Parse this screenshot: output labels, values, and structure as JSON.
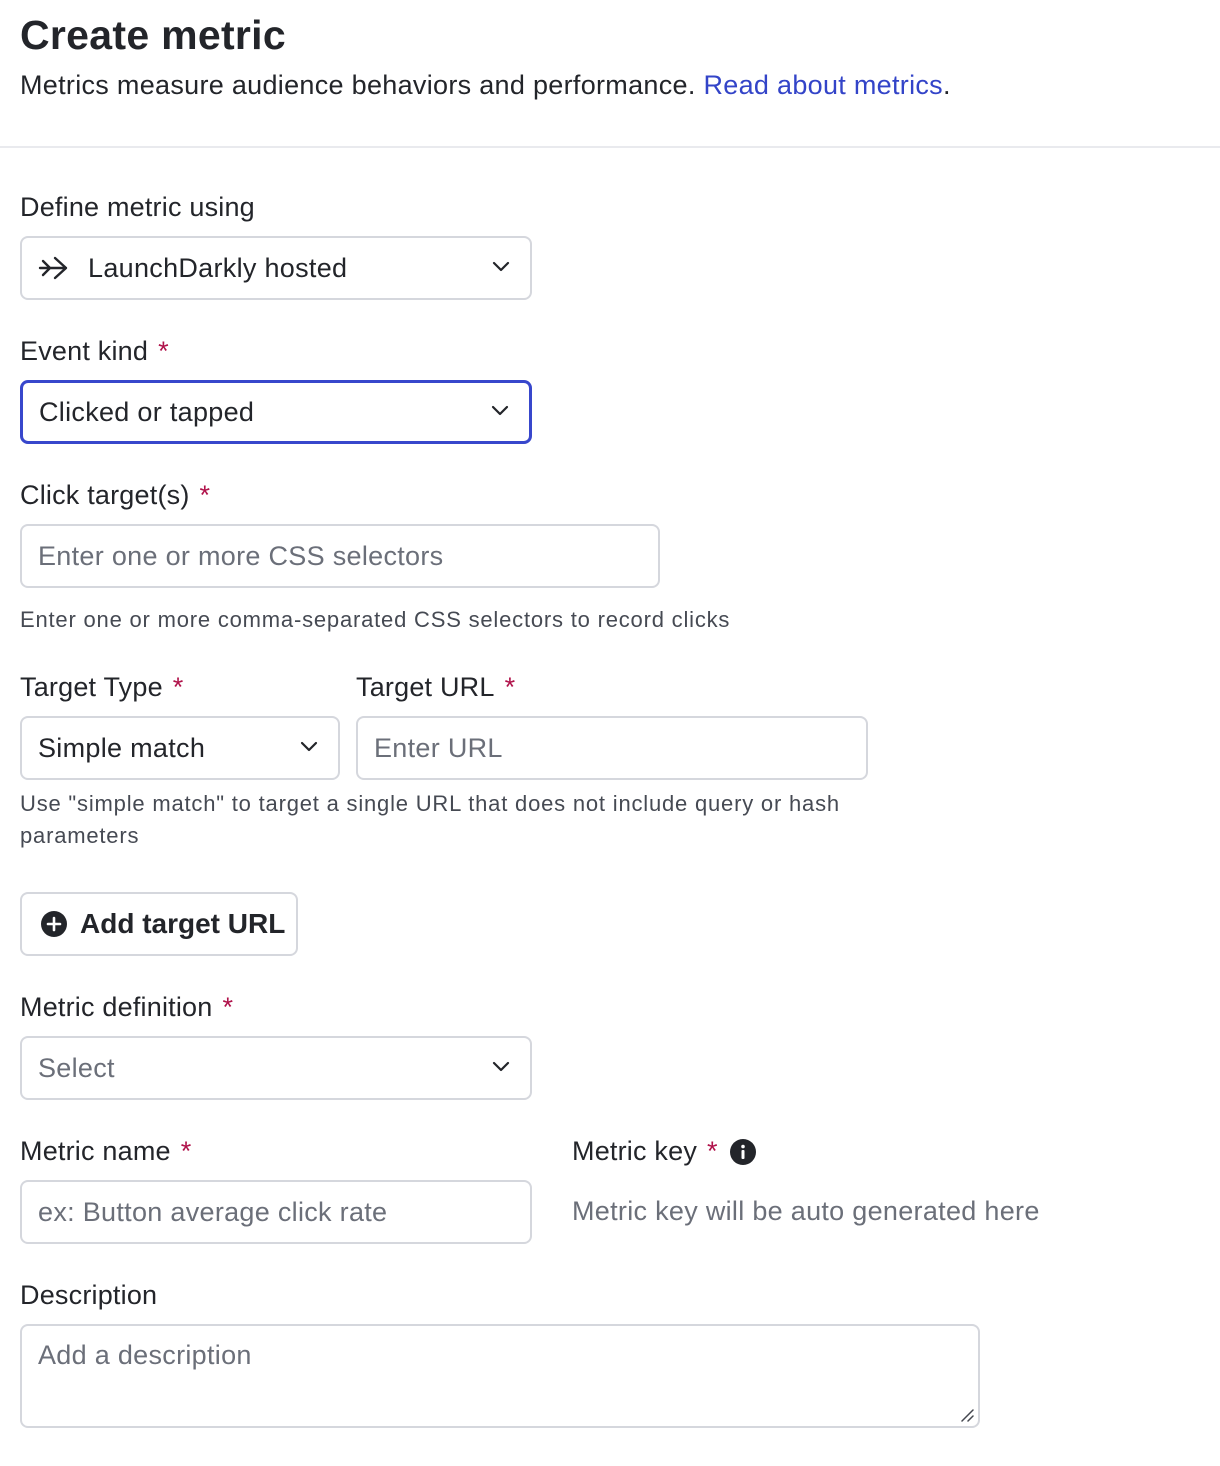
{
  "header": {
    "title": "Create metric",
    "subtitle": "Metrics measure audience behaviors and performance.",
    "link": "Read about metrics",
    "link_suffix": "."
  },
  "define_metric": {
    "label": "Define metric using",
    "value": "LaunchDarkly hosted",
    "icon": "arrow-right-icon"
  },
  "event_kind": {
    "label": "Event kind",
    "required": "*",
    "value": "Clicked or tapped"
  },
  "click_targets": {
    "label": "Click target(s)",
    "required": "*",
    "placeholder": "Enter one or more CSS selectors",
    "help": "Enter one or more comma-separated CSS selectors to record clicks"
  },
  "target_type": {
    "label": "Target Type",
    "required": "*",
    "value": "Simple match"
  },
  "target_url": {
    "label": "Target URL",
    "required": "*",
    "placeholder": "Enter URL",
    "help": "Use \"simple match\" to target a single URL that does not include query or hash parameters"
  },
  "add_target": {
    "label": "Add target URL",
    "icon": "plus-circle-icon"
  },
  "metric_definition": {
    "label": "Metric definition",
    "required": "*",
    "placeholder": "Select"
  },
  "metric_name": {
    "label": "Metric name",
    "required": "*",
    "placeholder": "ex: Button average click rate"
  },
  "metric_key": {
    "label": "Metric key",
    "required": "*",
    "icon": "info-icon",
    "placeholder": "Metric key will be auto generated here"
  },
  "description": {
    "label": "Description",
    "placeholder": "Add a description"
  },
  "colors": {
    "accent": "#3847cc",
    "link": "#3344c8",
    "required": "#b0124a",
    "border": "#d5d7dd"
  }
}
